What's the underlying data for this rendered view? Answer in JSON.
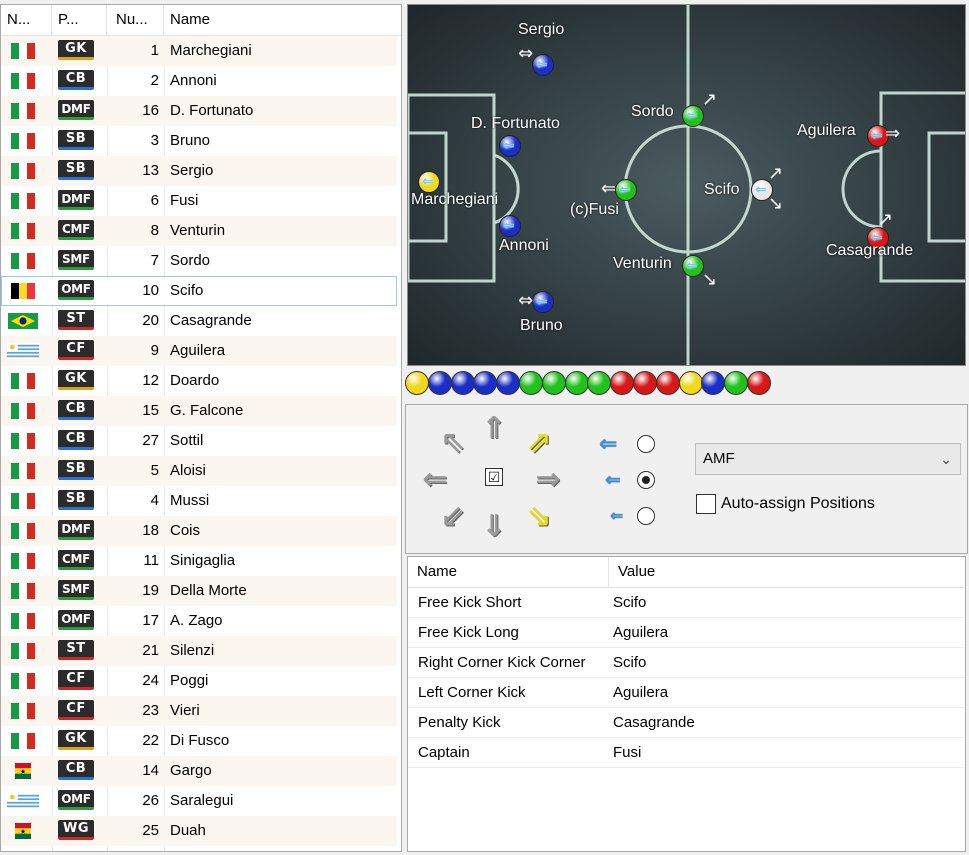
{
  "list": {
    "headers": [
      "N...",
      "P...",
      "Nu...",
      "Name"
    ],
    "players": [
      {
        "flag": "italy",
        "pos": "GK",
        "num": "1",
        "name": "Marchegiani"
      },
      {
        "flag": "italy",
        "pos": "CB",
        "num": "2",
        "name": "Annoni"
      },
      {
        "flag": "italy",
        "pos": "DMF",
        "num": "16",
        "name": "D. Fortunato"
      },
      {
        "flag": "italy",
        "pos": "SB",
        "num": "3",
        "name": "Bruno"
      },
      {
        "flag": "italy",
        "pos": "SB",
        "num": "13",
        "name": "Sergio"
      },
      {
        "flag": "italy",
        "pos": "DMF",
        "num": "6",
        "name": "Fusi"
      },
      {
        "flag": "italy",
        "pos": "CMF",
        "num": "8",
        "name": "Venturin"
      },
      {
        "flag": "italy",
        "pos": "SMF",
        "num": "7",
        "name": "Sordo"
      },
      {
        "flag": "belgium",
        "pos": "OMF",
        "num": "10",
        "name": "Scifo"
      },
      {
        "flag": "brazil",
        "pos": "ST",
        "num": "20",
        "name": "Casagrande"
      },
      {
        "flag": "uruguay",
        "pos": "CF",
        "num": "9",
        "name": "Aguilera"
      },
      {
        "flag": "italy",
        "pos": "GK",
        "num": "12",
        "name": "Doardo"
      },
      {
        "flag": "italy",
        "pos": "CB",
        "num": "15",
        "name": "G. Falcone"
      },
      {
        "flag": "italy",
        "pos": "CB",
        "num": "27",
        "name": "Sottil"
      },
      {
        "flag": "italy",
        "pos": "SB",
        "num": "5",
        "name": "Aloisi"
      },
      {
        "flag": "italy",
        "pos": "SB",
        "num": "4",
        "name": "Mussi"
      },
      {
        "flag": "italy",
        "pos": "DMF",
        "num": "18",
        "name": "Cois"
      },
      {
        "flag": "italy",
        "pos": "CMF",
        "num": "11",
        "name": "Sinigaglia"
      },
      {
        "flag": "italy",
        "pos": "SMF",
        "num": "19",
        "name": "Della Morte"
      },
      {
        "flag": "italy",
        "pos": "OMF",
        "num": "17",
        "name": "A. Zago"
      },
      {
        "flag": "italy",
        "pos": "ST",
        "num": "21",
        "name": "Silenzi"
      },
      {
        "flag": "italy",
        "pos": "CF",
        "num": "24",
        "name": "Poggi"
      },
      {
        "flag": "italy",
        "pos": "CF",
        "num": "23",
        "name": "Vieri"
      },
      {
        "flag": "italy",
        "pos": "GK",
        "num": "22",
        "name": "Di Fusco"
      },
      {
        "flag": "ghana",
        "pos": "CB",
        "num": "14",
        "name": "Gargo"
      },
      {
        "flag": "uruguay",
        "pos": "OMF",
        "num": "26",
        "name": "Saralegui"
      },
      {
        "flag": "ghana",
        "pos": "WG",
        "num": "25",
        "name": "Duah"
      }
    ],
    "selected_player": "Scifo"
  },
  "pitch": {
    "players": [
      {
        "label": "Sergio",
        "color": "blue"
      },
      {
        "label": "D. Fortunato",
        "color": "blue"
      },
      {
        "label": "Marchegiani",
        "color": "yellow"
      },
      {
        "label": "Annoni",
        "color": "blue"
      },
      {
        "label": "Bruno",
        "color": "blue"
      },
      {
        "label": "Sordo",
        "color": "green"
      },
      {
        "label": "(c)Fusi",
        "color": "green"
      },
      {
        "label": "Venturin",
        "color": "green"
      },
      {
        "label": "Scifo",
        "color": "white"
      },
      {
        "label": "Aguilera",
        "color": "red"
      },
      {
        "label": "Casagrande",
        "color": "red"
      }
    ]
  },
  "ball_strip": [
    "yellow",
    "blue",
    "blue",
    "blue",
    "blue",
    "green",
    "green",
    "green",
    "green",
    "red",
    "red",
    "red",
    "yellow",
    "blue",
    "green",
    "red"
  ],
  "colors": {
    "yellow": "#f2d81a",
    "blue": "#1b2fc8",
    "green": "#22c21c",
    "red": "#d81818",
    "white": "#e8e8e8"
  },
  "controls": {
    "direction_icons": [
      "arrow-up-left-icon",
      "arrow-up-icon",
      "arrow-up-right-icon",
      "arrow-left-icon",
      "arrow-right-icon",
      "arrow-down-left-icon",
      "arrow-down-icon",
      "arrow-down-right-icon"
    ],
    "center_checked": true,
    "speed_selected": 1,
    "position_value": "AMF",
    "auto_assign_label": "Auto-assign Positions",
    "auto_assign_checked": false
  },
  "properties": {
    "headers": [
      "Name",
      "Value"
    ],
    "rows": [
      {
        "key": "Free Kick Short",
        "value": "Scifo"
      },
      {
        "key": "Free Kick Long",
        "value": "Aguilera"
      },
      {
        "key": "Right Corner Kick Corner",
        "value": "Scifo"
      },
      {
        "key": "Left Corner Kick",
        "value": "Aguilera"
      },
      {
        "key": "Penalty Kick",
        "value": "Casagrande"
      },
      {
        "key": "Captain",
        "value": "Fusi"
      }
    ]
  }
}
